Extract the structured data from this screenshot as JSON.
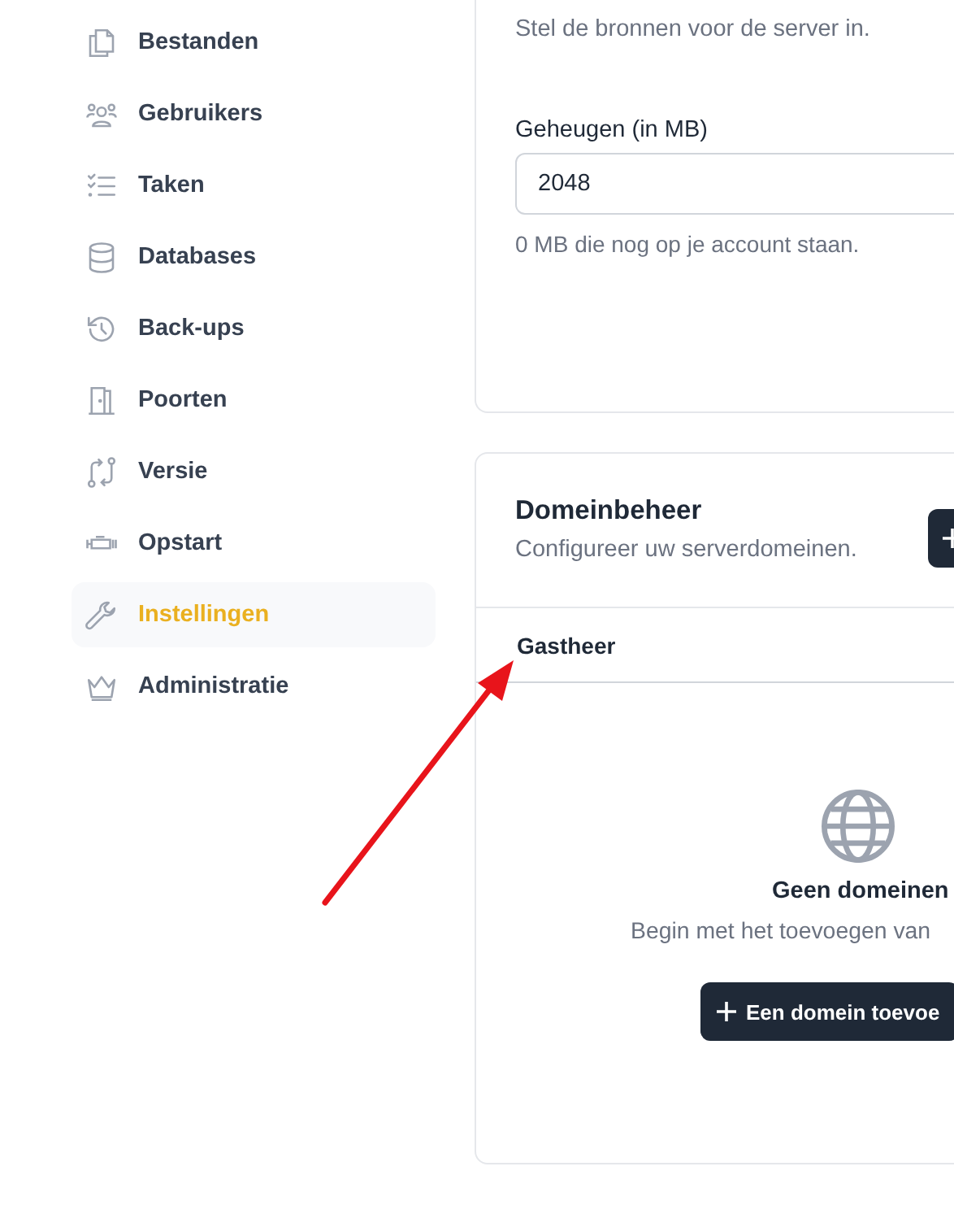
{
  "sidebar": {
    "items": [
      {
        "label": "Bestanden",
        "selected": false
      },
      {
        "label": "Gebruikers",
        "selected": false
      },
      {
        "label": "Taken",
        "selected": false
      },
      {
        "label": "Databases",
        "selected": false
      },
      {
        "label": "Back-ups",
        "selected": false
      },
      {
        "label": "Poorten",
        "selected": false
      },
      {
        "label": "Versie",
        "selected": false
      },
      {
        "label": "Opstart",
        "selected": false
      },
      {
        "label": "Instellingen",
        "selected": true
      },
      {
        "label": "Administratie",
        "selected": false
      }
    ]
  },
  "resources_card": {
    "subtitle": "Stel de bronnen voor de server in.",
    "field": {
      "label": "Geheugen (in MB)",
      "value": "2048",
      "help": "0 MB die nog op je account staan."
    }
  },
  "domains_card": {
    "title": "Domeinbeheer",
    "subtitle": "Configureer uw serverdomeinen.",
    "table": {
      "columns": [
        "Gastheer"
      ]
    },
    "empty_state": {
      "title": "Geen domeinen",
      "text": "Begin met het toevoegen van",
      "button": "Een domein toevoe"
    }
  },
  "annotation": {
    "kind": "arrow",
    "color": "#e8141b"
  }
}
